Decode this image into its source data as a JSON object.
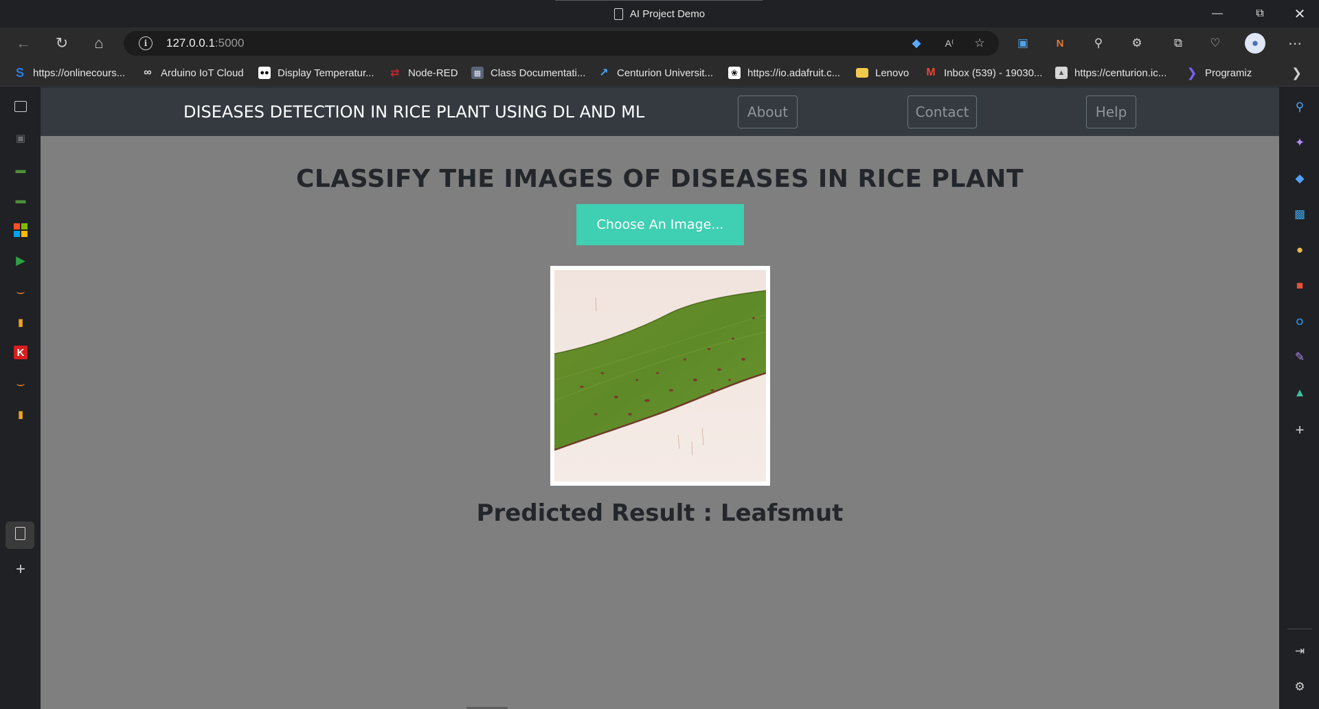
{
  "window": {
    "title": "AI Project Demo",
    "controls": [
      "minimize",
      "restore",
      "close"
    ]
  },
  "address_bar": {
    "host": "127.0.0.1",
    "port": ":5000"
  },
  "bookmarks": [
    {
      "label": "https://onlinecours...",
      "icon": "s-logo-icon",
      "color": "#2b7de9"
    },
    {
      "label": "Arduino IoT Cloud",
      "icon": "infinity-icon",
      "color": "#dddddd"
    },
    {
      "label": "Display Temperatur...",
      "icon": "medium-icon",
      "color": "#ffffff"
    },
    {
      "label": "Node-RED",
      "icon": "node-red-icon",
      "color": "#c1272d"
    },
    {
      "label": "Class Documentati...",
      "icon": "book-icon",
      "color": "#b0b8c8"
    },
    {
      "label": "Centurion Universit...",
      "icon": "external-link-icon",
      "color": "#4da3ff"
    },
    {
      "label": "https://io.adafruit.c...",
      "icon": "adafruit-icon",
      "color": "#ffffff"
    },
    {
      "label": "Lenovo",
      "icon": "folder-icon",
      "color": "#f2c94c"
    },
    {
      "label": "Inbox (539) - 19030...",
      "icon": "gmail-icon",
      "color": "#ea4335"
    },
    {
      "label": "https://centurion.ic...",
      "icon": "image-icon",
      "color": "#cccccc"
    },
    {
      "label": "Programiz",
      "icon": "programiz-icon",
      "color": "#7b61ff"
    }
  ],
  "page": {
    "brand": "DISEASES DETECTION IN RICE PLANT USING DL AND ML",
    "nav": {
      "about": "About",
      "contact": "Contact",
      "help": "Help"
    },
    "heading": "CLASSIFY THE IMAGES OF DISEASES IN RICE PLANT",
    "choose_button": "Choose An Image...",
    "result": "Predicted Result : Leafsmut"
  },
  "colors": {
    "navbar": "#343a40",
    "page_bg": "#7f7f7f",
    "accent_button": "#3fcfb2"
  }
}
